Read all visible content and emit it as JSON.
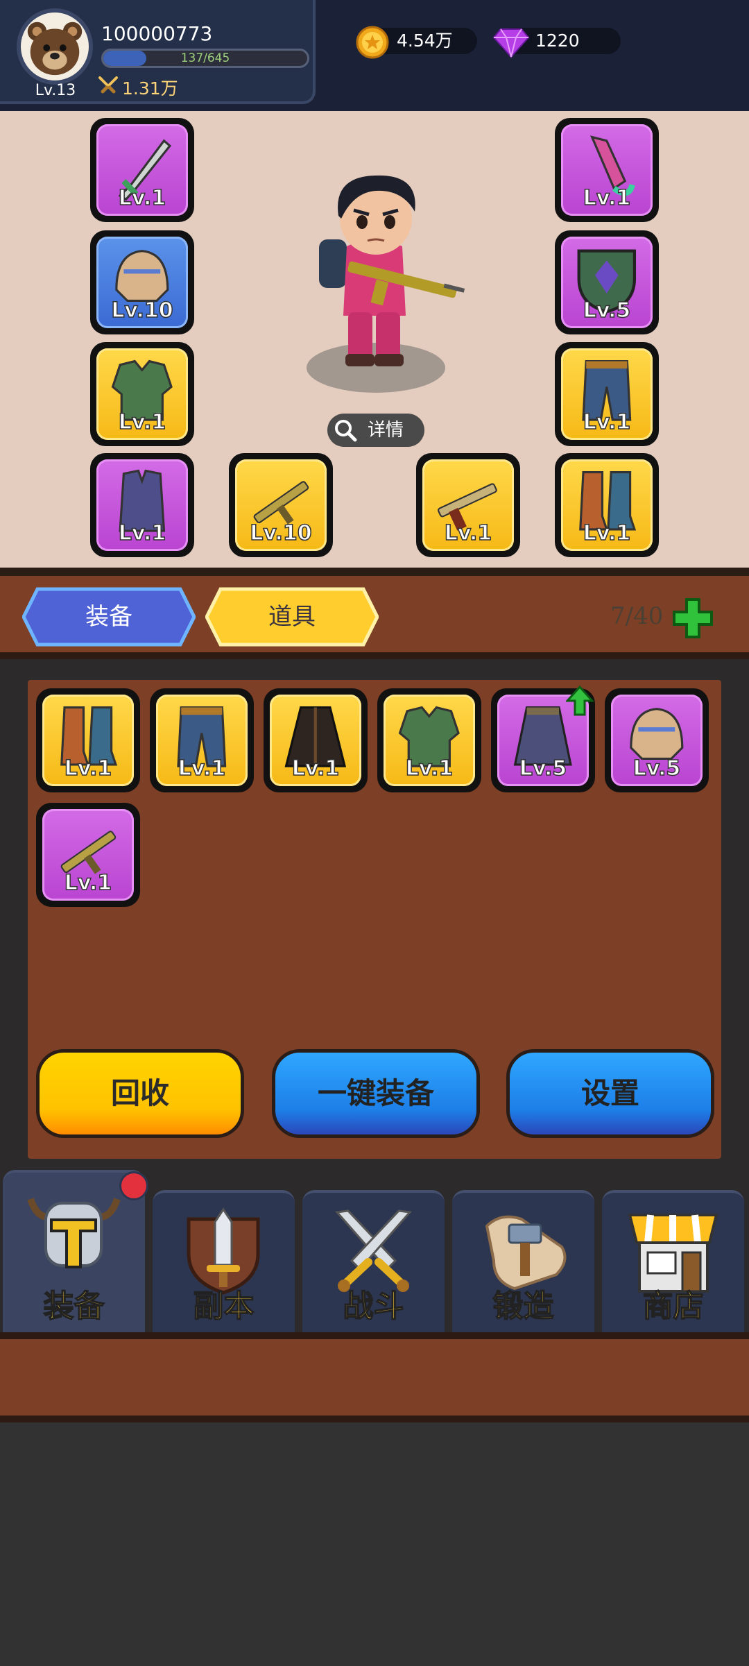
{
  "header": {
    "player_id": "100000773",
    "level": "Lv.13",
    "exp_text": "137/645",
    "exp_fraction": 0.2124,
    "power": "1.31万",
    "coins": "4.54万",
    "gems": "1220",
    "coin_icon": "gold-coin-icon",
    "gem_icon": "purple-diamond-icon"
  },
  "equipped": {
    "left": [
      {
        "level": "Lv.1",
        "rarity": "purple",
        "icon": "dagger-icon"
      },
      {
        "level": "Lv.10",
        "rarity": "blue",
        "icon": "helmet-icon"
      },
      {
        "level": "Lv.1",
        "rarity": "yellow",
        "icon": "armor-icon"
      },
      {
        "level": "Lv.1",
        "rarity": "purple",
        "icon": "vest-icon"
      }
    ],
    "right": [
      {
        "level": "Lv.1",
        "rarity": "purple",
        "icon": "knife-icon"
      },
      {
        "level": "Lv.5",
        "rarity": "purple",
        "icon": "shield-icon"
      },
      {
        "level": "Lv.1",
        "rarity": "yellow",
        "icon": "pants-icon"
      },
      {
        "level": "Lv.1",
        "rarity": "yellow",
        "icon": "boots-icon"
      }
    ],
    "bottom_weapons": [
      {
        "level": "Lv.10",
        "rarity": "yellow",
        "icon": "rifle-icon"
      },
      {
        "level": "Lv.1",
        "rarity": "yellow",
        "icon": "shotgun-icon"
      }
    ],
    "details_label": "详情"
  },
  "tabs": {
    "equip_label": "装备",
    "items_label": "道具",
    "bag_count": "7/40"
  },
  "bag": {
    "items": [
      {
        "level": "Lv.1",
        "rarity": "yellow",
        "icon": "boots-icon"
      },
      {
        "level": "Lv.1",
        "rarity": "yellow",
        "icon": "pants-icon"
      },
      {
        "level": "Lv.1",
        "rarity": "yellow",
        "icon": "cloak-icon"
      },
      {
        "level": "Lv.1",
        "rarity": "yellow",
        "icon": "armor-icon"
      },
      {
        "level": "Lv.5",
        "rarity": "purple",
        "icon": "skirt-icon",
        "upgrade": true
      },
      {
        "level": "Lv.5",
        "rarity": "purple",
        "icon": "helmet-icon"
      },
      {
        "level": "Lv.1",
        "rarity": "purple",
        "icon": "rifle-icon"
      }
    ]
  },
  "actions": {
    "recycle": "回收",
    "one_key_equip": "一键装备",
    "settings": "设置"
  },
  "nav": {
    "items": [
      {
        "label": "装备",
        "icon": "helmet-nav-icon"
      },
      {
        "label": "副本",
        "icon": "sword-shield-icon"
      },
      {
        "label": "战斗",
        "icon": "crossed-swords-icon"
      },
      {
        "label": "锻造",
        "icon": "hammer-scroll-icon"
      },
      {
        "label": "商店",
        "icon": "shop-icon"
      }
    ]
  },
  "colors": {
    "purple": "#c455dc",
    "yellow": "#ffcf2e",
    "blue": "#4a7fe0",
    "brown": "#7d3f25"
  }
}
